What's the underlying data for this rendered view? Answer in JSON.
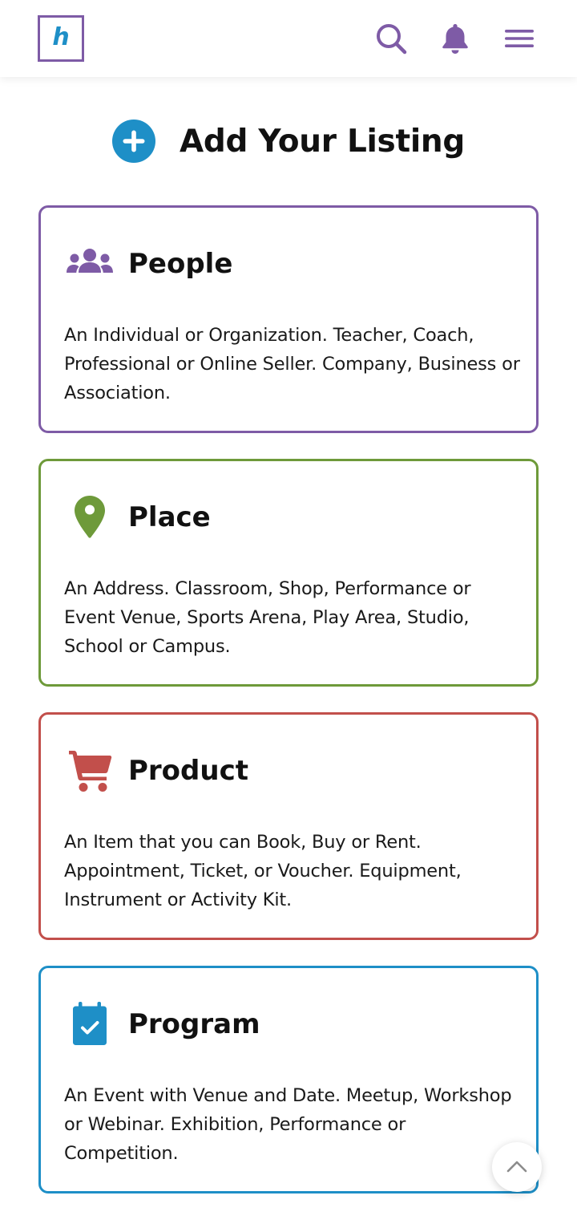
{
  "header": {
    "logo_letter": "h",
    "icons": [
      "search-icon",
      "bell-icon",
      "menu-icon"
    ]
  },
  "colors": {
    "brand_purple": "#7e5ba6",
    "accent_blue": "#1e8fc7",
    "people": "#7e5ba6",
    "place": "#6e9a3a",
    "product": "#c24f4b",
    "program": "#1e8fc7"
  },
  "page": {
    "title": "Add Your Listing",
    "title_icon": "plus-circle-icon"
  },
  "cards": [
    {
      "icon": "people-icon",
      "title": "People",
      "description": "An Individual or Organization.  Teacher, Coach, Professional or Online Seller.  Company, Business or Association."
    },
    {
      "icon": "map-pin-icon",
      "title": "Place",
      "description": "An Address.  Classroom, Shop, Performance or Event Venue, Sports Arena, Play Area, Studio, School or Campus."
    },
    {
      "icon": "cart-icon",
      "title": "Product",
      "description": "An Item that you can Book, Buy or Rent. Appointment, Ticket, or Voucher.  Equipment, Instrument or Activity Kit."
    },
    {
      "icon": "calendar-check-icon",
      "title": "Program",
      "description": "An Event with Venue and Date.  Meetup, Workshop or Webinar.  Exhibition, Performance or Competition."
    }
  ],
  "scroll_top_icon": "chevron-up-icon"
}
